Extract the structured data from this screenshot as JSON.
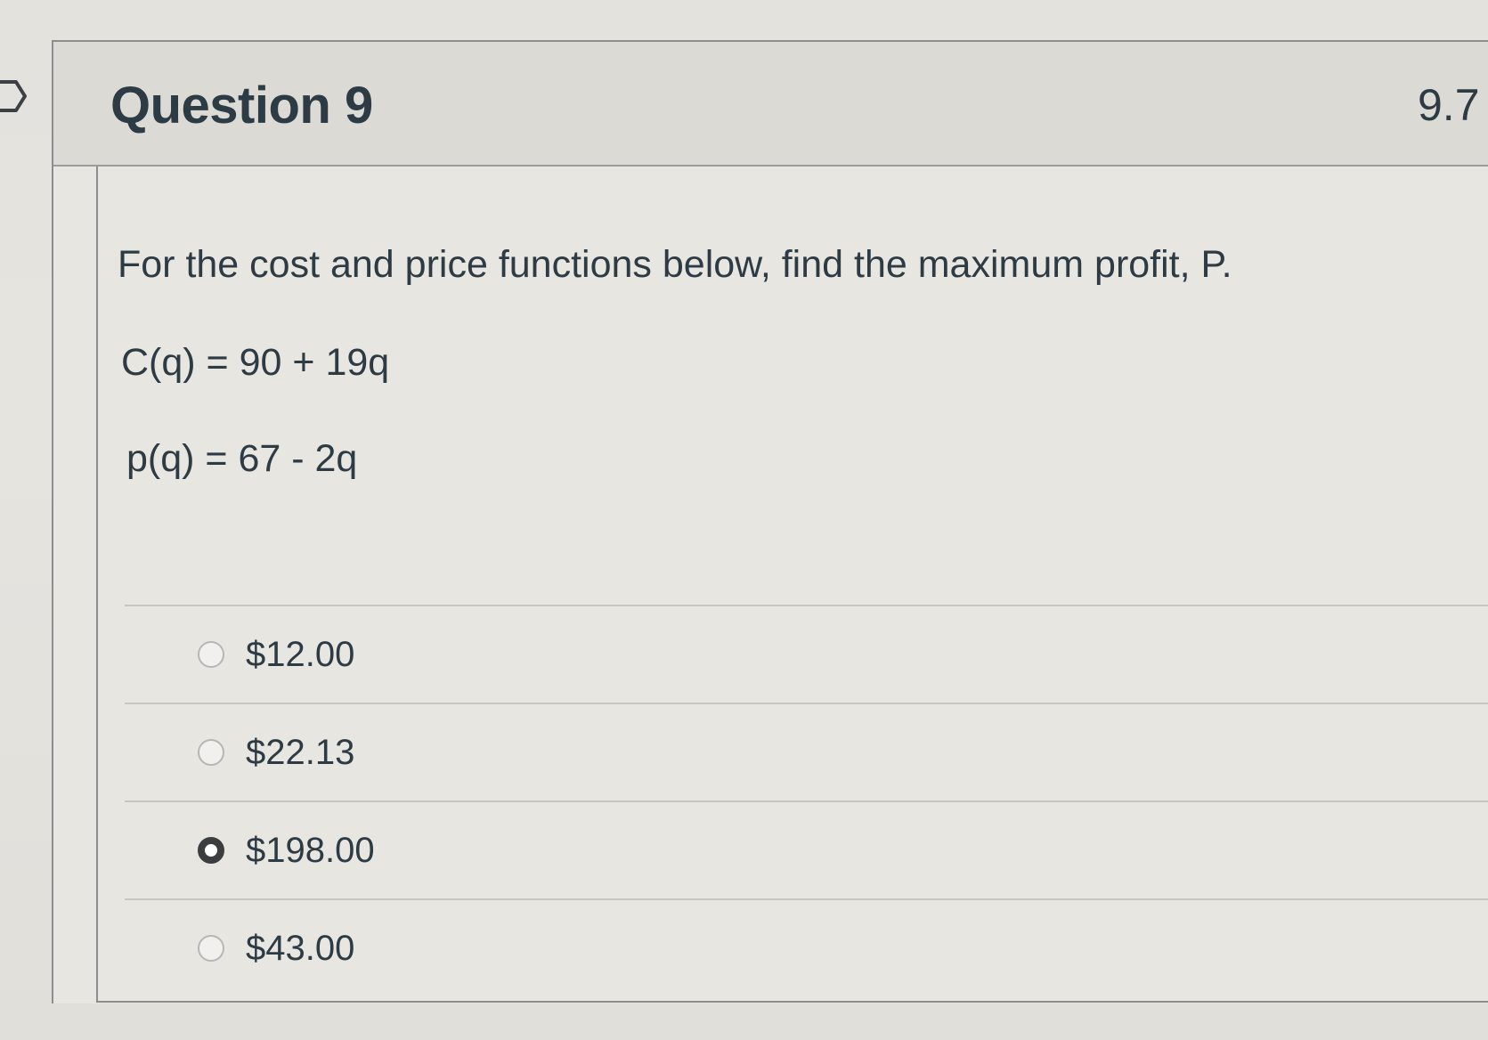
{
  "question": {
    "title": "Question 9",
    "points": "9.7",
    "prompt": "For the cost and price functions below, find the maximum profit, P.",
    "equations": [
      "C(q) = 90 + 19q",
      "p(q) = 67 - 2q"
    ],
    "answers": [
      {
        "label": "$12.00",
        "selected": false
      },
      {
        "label": "$22.13",
        "selected": false
      },
      {
        "label": "$198.00",
        "selected": true
      },
      {
        "label": "$43.00",
        "selected": false
      }
    ]
  },
  "icons": {
    "nav": "chevron-right-icon"
  }
}
